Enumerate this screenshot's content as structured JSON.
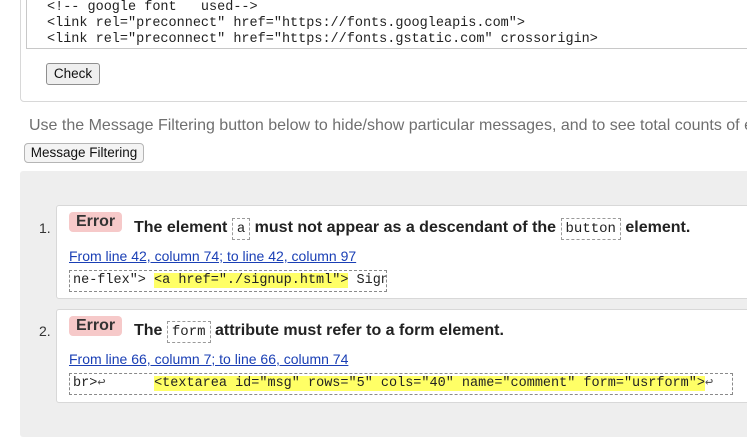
{
  "source": {
    "lines": [
      "<!-- google font   used-->",
      "<link rel=\"preconnect\" href=\"https://fonts.googleapis.com\">",
      "<link rel=\"preconnect\" href=\"https://fonts.gstatic.com\" crossorigin>"
    ],
    "check_label": "Check"
  },
  "filter": {
    "hint": "Use the Message Filtering button below to hide/show particular messages, and to see total counts of e",
    "button_label": "Message Filtering"
  },
  "messages": [
    {
      "number": "1.",
      "type": "Error",
      "title_before": "The element",
      "code": "a",
      "title_after": "must not appear as a descendant of the",
      "code2": "button",
      "title_end": "element.",
      "location": "From line 42, column 74; to line 42, column 97",
      "extract_before": "ne-flex\"> ",
      "extract_highlight": "<a href=\"./signup.html\">",
      "extract_after": " Signu"
    },
    {
      "number": "2.",
      "type": "Error",
      "title_before": "The",
      "code": "form",
      "title_after": "attribute must refer to a form element.",
      "location": "From line 66, column 7; to line 66, column 74",
      "extract_before": "br>",
      "extract_newline": "↩",
      "extract_spacer": "      ",
      "extract_highlight": "<textarea id=\"msg\" rows=\"5\" cols=\"40\" name=\"comment\" form=\"usrform\">",
      "extract_newline_end": "↩"
    }
  ]
}
